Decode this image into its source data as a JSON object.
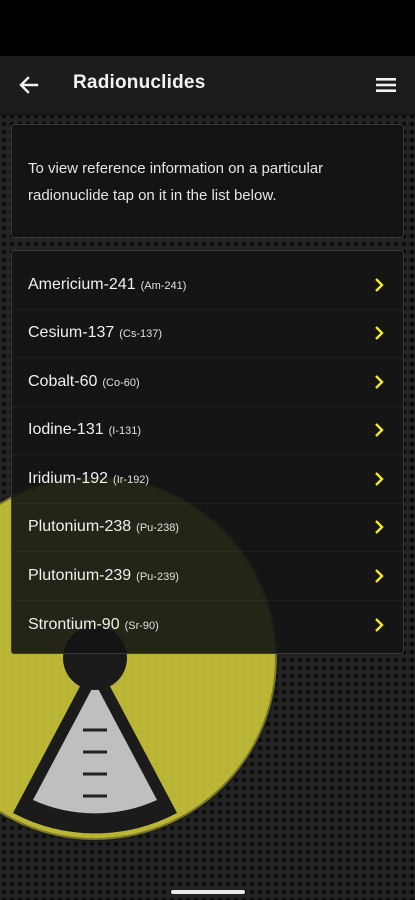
{
  "header": {
    "title": "Radionuclides",
    "back_icon": "arrow-left-icon",
    "menu_icon": "hamburger-menu-icon"
  },
  "info": {
    "text": "To view reference information on a particular radionuclide tap on it in the list below."
  },
  "radionuclides": [
    {
      "name": "Americium-241",
      "symbol": "(Am-241)"
    },
    {
      "name": "Cesium-137",
      "symbol": "(Cs-137)"
    },
    {
      "name": "Cobalt-60",
      "symbol": "(Co-60)"
    },
    {
      "name": "Iodine-131",
      "symbol": "(I-131)"
    },
    {
      "name": "Iridium-192",
      "symbol": "(Ir-192)"
    },
    {
      "name": "Plutonium-238",
      "symbol": "(Pu-238)"
    },
    {
      "name": "Plutonium-239",
      "symbol": "(Pu-239)"
    },
    {
      "name": "Strontium-90",
      "symbol": "(Sr-90)"
    }
  ],
  "colors": {
    "accent": "#f2e829",
    "hazard_yellow": "#d8d23a",
    "background": "#232323"
  }
}
